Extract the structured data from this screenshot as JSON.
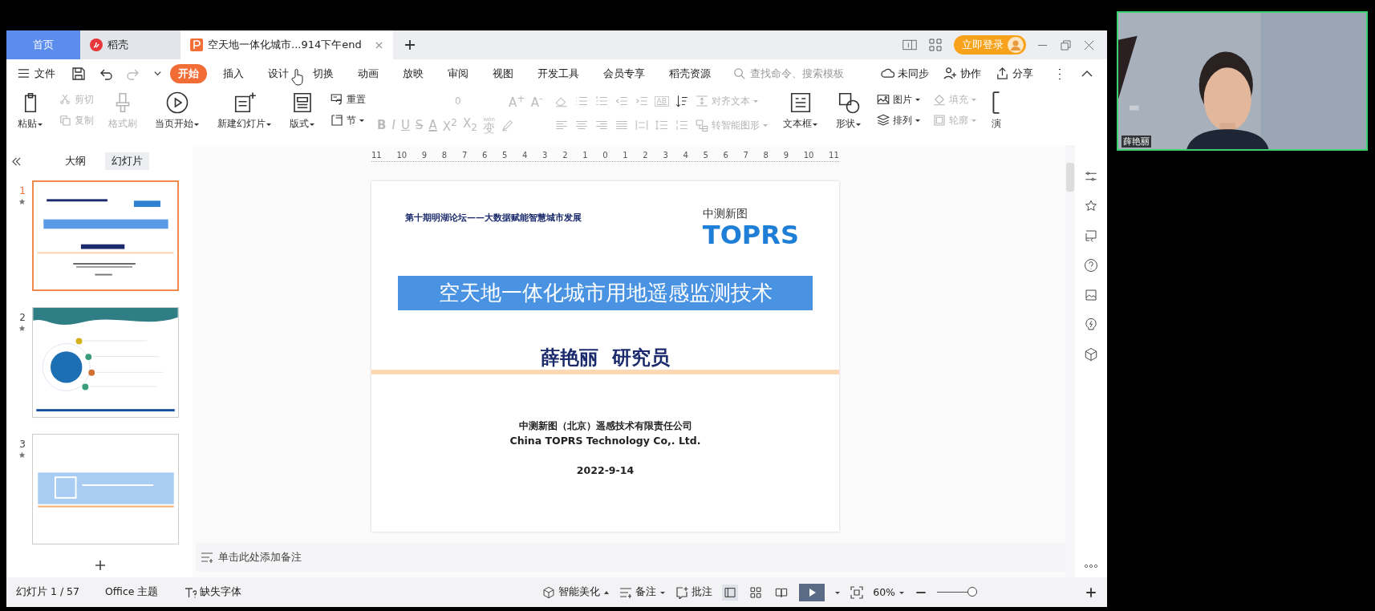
{
  "app_tabs": [
    {
      "label": "首页",
      "kind": "home",
      "selected": false
    },
    {
      "label": "稻壳",
      "kind": "docer",
      "selected": false
    },
    {
      "label": "空天地一体化城市...914下午end",
      "kind": "document",
      "selected": true
    }
  ],
  "login_button": "立即登录",
  "menu": {
    "file": "文件",
    "tabs": [
      {
        "label": "开始",
        "selected": true
      },
      {
        "label": "插入",
        "selected": false
      },
      {
        "label": "设计",
        "selected": false
      },
      {
        "label": "切换",
        "selected": false
      },
      {
        "label": "动画",
        "selected": false
      },
      {
        "label": "放映",
        "selected": false
      },
      {
        "label": "审阅",
        "selected": false
      },
      {
        "label": "视图",
        "selected": false
      },
      {
        "label": "开发工具",
        "selected": false
      },
      {
        "label": "会员专享",
        "selected": false
      },
      {
        "label": "稻壳资源",
        "selected": false
      }
    ],
    "search": {
      "placeholder": "查找命令、搜索模板"
    },
    "actions": [
      {
        "label": "未同步",
        "kind": "sync"
      },
      {
        "label": "协作",
        "kind": "collab"
      },
      {
        "label": "分享",
        "kind": "share"
      }
    ]
  },
  "ribbon": {
    "columns": [
      {
        "kind": "big",
        "item": {
          "label": "粘贴",
          "kind": "paste",
          "dropdown": true,
          "disabled": false
        }
      },
      {
        "kind": "stack",
        "items": [
          {
            "label": "剪切",
            "kind": "cut",
            "dropdown": false,
            "disabled": true
          },
          {
            "label": "复制",
            "kind": "copy",
            "dropdown": false,
            "disabled": true
          }
        ]
      },
      {
        "kind": "big",
        "item": {
          "label": "格式刷",
          "kind": "brush",
          "dropdown": false,
          "disabled": true
        }
      },
      {
        "kind": "big",
        "item": {
          "label": "当页开始",
          "kind": "play",
          "dropdown": true,
          "disabled": false
        }
      },
      {
        "kind": "big",
        "item": {
          "label": "新建幻灯片",
          "kind": "newslide",
          "dropdown": true,
          "disabled": false
        }
      },
      {
        "kind": "big",
        "item": {
          "label": "版式",
          "kind": "layout",
          "dropdown": true,
          "disabled": false
        }
      },
      {
        "kind": "stack",
        "items": [
          {
            "label": "重置",
            "kind": "reset",
            "dropdown": false,
            "disabled": false
          },
          {
            "label": "节",
            "kind": "section",
            "dropdown": true,
            "disabled": false
          }
        ]
      },
      {
        "kind": "font",
        "font_size": "0",
        "grow": "A$^{+}$",
        "shrink": "A$^{-}$",
        "buttons": [
          {
            "label": "B",
            "kind": "bold"
          },
          {
            "label": "I",
            "kind": "italic"
          },
          {
            "label": "U",
            "kind": "underline"
          },
          {
            "label": "S",
            "kind": "strike"
          },
          {
            "label": "A",
            "kind": "color"
          },
          {
            "label": "X$^{2}$",
            "kind": "super"
          },
          {
            "label": "X$_{2}$",
            "kind": "sub"
          },
          {
            "label": "变",
            "kind": "phonetic",
            "ruby": "wén"
          }
        ]
      },
      {
        "kind": "paragraph",
        "direction": "AB",
        "items": [
          {
            "label": "对齐文本",
            "kind": "align",
            "dropdown": true,
            "disabled": true
          },
          {
            "label": "转智能图形",
            "kind": "smartart",
            "dropdown": true,
            "disabled": true
          }
        ]
      },
      {
        "kind": "big",
        "item": {
          "label": "文本框",
          "kind": "textbox",
          "dropdown": true,
          "disabled": false
        }
      },
      {
        "kind": "big",
        "item": {
          "label": "形状",
          "kind": "shape",
          "dropdown": true,
          "disabled": false
        }
      },
      {
        "kind": "stack",
        "items": [
          {
            "label": "图片",
            "kind": "picture",
            "dropdown": true,
            "disabled": false
          },
          {
            "label": "排列",
            "kind": "arrange",
            "dropdown": true,
            "disabled": false
          }
        ]
      },
      {
        "kind": "stack",
        "items": [
          {
            "label": "填充",
            "kind": "fill",
            "dropdown": true,
            "disabled": true
          },
          {
            "label": "轮廓",
            "kind": "outline",
            "dropdown": true,
            "disabled": true
          }
        ]
      },
      {
        "kind": "big",
        "item": {
          "label": "演",
          "kind": "present",
          "dropdown": false,
          "disabled": false
        }
      }
    ]
  },
  "panel_tabs": [
    {
      "label": "大纲",
      "selected": false
    },
    {
      "label": "幻灯片",
      "selected": true
    }
  ],
  "thumbnails": [
    {
      "number": "1",
      "kind": "title",
      "selected": true
    },
    {
      "number": "2",
      "kind": "contents",
      "selected": false
    },
    {
      "number": "3",
      "kind": "section",
      "selected": false
    }
  ],
  "ruler": [
    "11",
    "10",
    "9",
    "8",
    "7",
    "6",
    "5",
    "4",
    "3",
    "2",
    "1",
    "0",
    "1",
    "2",
    "3",
    "4",
    "5",
    "6",
    "7",
    "8",
    "9",
    "10",
    "11"
  ],
  "slide": {
    "header": "第十期明湖论坛——大数据赋能智慧城市发展",
    "logo_cn": "中测新图",
    "logo_en": "TOPRS",
    "title": "空天地一体化城市用地遥感监测技术",
    "speaker": "薛艳丽  研究员",
    "company_cn": "中测新图（北京）遥感技术有限责任公司",
    "company_en": "China TOPRS Technology Co,. Ltd.",
    "date": "2022-9-14"
  },
  "notes": {
    "placeholder": "单击此处添加备注"
  },
  "status_bar": {
    "slide_counter": "幻灯片 1 / 57",
    "theme": "Office 主题",
    "missing_fonts": "缺失字体",
    "beautify": "智能美化",
    "notes": "备注",
    "comments": "批注",
    "views": [
      {
        "kind": "normal",
        "selected": true
      },
      {
        "kind": "sorter",
        "selected": false
      },
      {
        "kind": "reading",
        "selected": false
      }
    ],
    "zoom": "60%",
    "zoom_slider": {
      "level": 0.85
    }
  },
  "webcam": {
    "name": "薛艳丽",
    "speaking": true
  }
}
